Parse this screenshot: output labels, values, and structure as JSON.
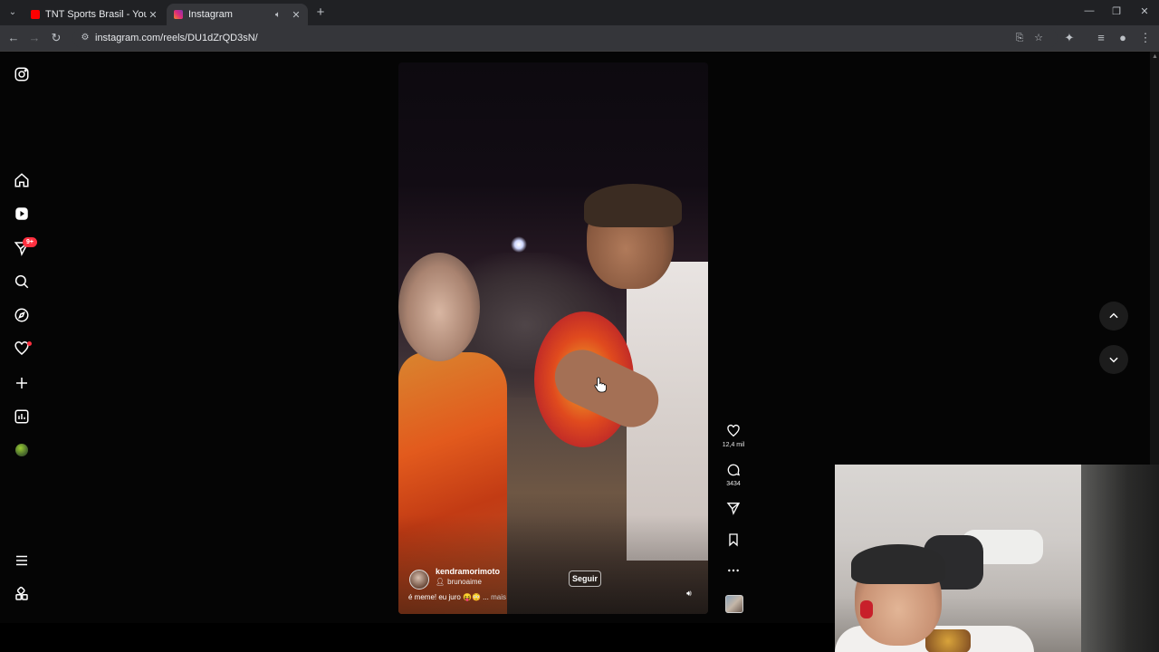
{
  "browser": {
    "tabs": [
      {
        "title": "TNT Sports Brasil - YouTube",
        "active": false,
        "favicon_color": "#ff0000"
      },
      {
        "title": "Instagram",
        "active": true,
        "favicon_color": "#e1306c",
        "audio": true
      }
    ],
    "url": "instagram.com/reels/DU1dZrQD3sN/"
  },
  "sidebar": {
    "notifications_badge": "9+",
    "items": [
      "instagram-logo",
      "home",
      "reels",
      "messages",
      "search",
      "explore",
      "notifications",
      "create",
      "dashboard",
      "profile",
      "more",
      "also-from-meta"
    ]
  },
  "reel": {
    "username": "kendramorimoto",
    "collaborator": "brunoaime",
    "follow_label": "Seguir",
    "caption": "é meme! eu juro 😝😳 ...",
    "more_label": "mais",
    "likes": "12,4 mil",
    "comments": "3434"
  },
  "colors": {
    "accent_badge": "#ff3040",
    "chrome_bg": "#202124",
    "toolbar_bg": "#35363a"
  }
}
